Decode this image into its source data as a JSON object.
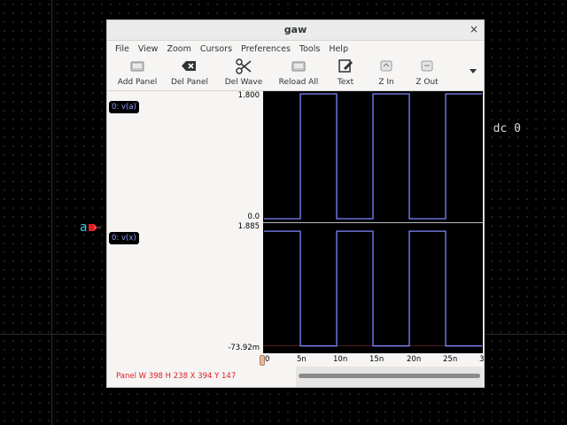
{
  "background": {
    "netlist_text": ") dc 0",
    "port_label": "a"
  },
  "window": {
    "title": "gaw",
    "close_glyph": "×"
  },
  "menu": [
    "File",
    "View",
    "Zoom",
    "Cursors",
    "Preferences",
    "Tools",
    "Help"
  ],
  "toolbar": {
    "add_panel": "Add Panel",
    "del_panel": "Del Panel",
    "del_wave": "Del Wave",
    "reload_all": "Reload All",
    "text": "Text",
    "z_in": "Z In",
    "z_out": "Z Out"
  },
  "panels": [
    {
      "wave_label": "0: v(a)",
      "y_max": "1.800",
      "y_min": "0.0"
    },
    {
      "wave_label": "0: v(x)",
      "y_max": "1.885",
      "y_min": "-73.92m"
    }
  ],
  "x_axis": {
    "ticks": [
      "0",
      "5n",
      "10n",
      "15n",
      "20n",
      "25n",
      "3"
    ]
  },
  "status": "Panel W 398 H 238 X 394 Y 147",
  "colors": {
    "wave": "#7b86ff",
    "status_text": "#e01b24",
    "wave_label": "#8f9cff"
  },
  "chart_data": [
    {
      "type": "line",
      "name": "0: v(a)",
      "ylim": [
        0,
        1.8
      ],
      "xlim": [
        0,
        30
      ],
      "x": [
        0,
        5,
        5,
        10,
        10,
        15,
        15,
        20,
        20,
        25,
        25,
        30
      ],
      "y": [
        0,
        0,
        1.8,
        1.8,
        0,
        0,
        1.8,
        1.8,
        0,
        0,
        1.8,
        1.8
      ]
    },
    {
      "type": "line",
      "name": "0: v(x)",
      "ylim": [
        -0.07392,
        1.885
      ],
      "xlim": [
        0,
        30
      ],
      "x": [
        0,
        5,
        5,
        10,
        10,
        15,
        15,
        20,
        20,
        25,
        25,
        30
      ],
      "y": [
        1.8,
        1.8,
        0,
        0,
        1.8,
        1.8,
        0,
        0,
        1.8,
        1.8,
        0,
        0
      ]
    }
  ]
}
